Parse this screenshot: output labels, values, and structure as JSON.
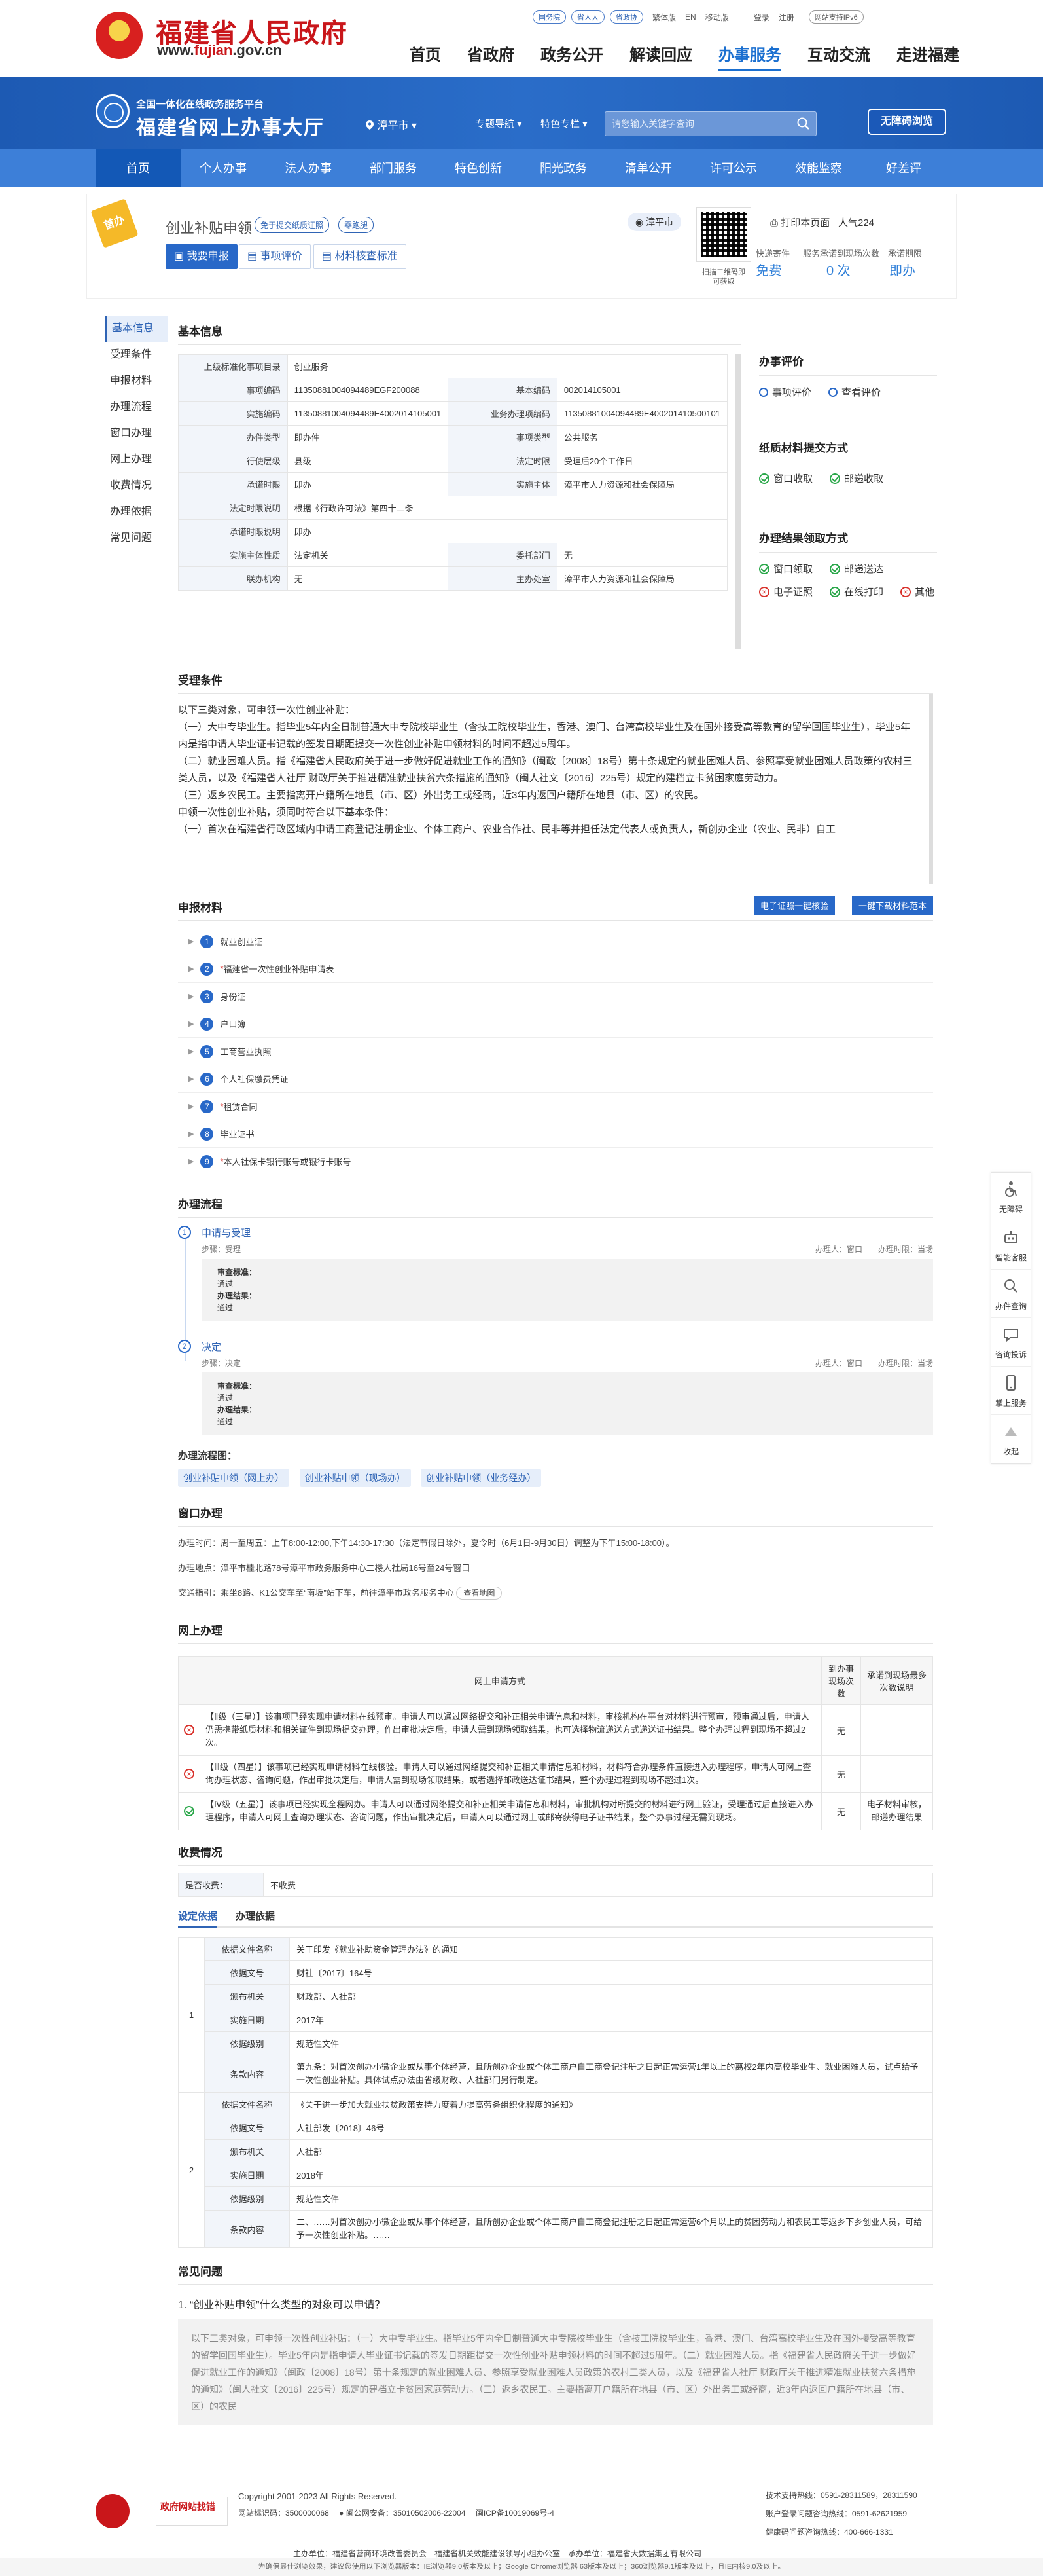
{
  "top": {
    "title": "福建省人民政府",
    "url_prefix": "www.",
    "url_main": "fujian",
    "url_suffix": ".gov.cn",
    "pill_links": [
      "国务院",
      "省人大",
      "省政协"
    ],
    "links": [
      "繁体版",
      "EN",
      "移动版",
      "登录",
      "注册"
    ],
    "ipv6": "网站支持IPv6",
    "nav": [
      "首页",
      "省政府",
      "政务公开",
      "解读回应",
      "办事服务",
      "互动交流",
      "走进福建"
    ],
    "nav_active": "办事服务"
  },
  "banner": {
    "sub": "全国一体化在线政务服务平台",
    "title": "福建省网上办事大厅",
    "city": "漳平市",
    "menu1": "专题导航",
    "menu2": "特色专栏",
    "search_placeholder": "请您输入关键字查询",
    "accessible": "无障碍浏览"
  },
  "subnav": [
    "首页",
    "个人办事",
    "法人办事",
    "部门服务",
    "特色创新",
    "阳光政务",
    "清单公开",
    "许可公示",
    "效能监察",
    "好差评"
  ],
  "item": {
    "ribbon": "首办",
    "title": "创业补贴申领",
    "tag1": "免于提交纸质证照",
    "tag2": "零跑腿",
    "btn_apply": "我要申报",
    "btn_eval": "事项评价",
    "btn_check": "材料核查标准",
    "location": "漳平市",
    "qr_label": "扫描二维码即可获取",
    "print": "打印本页面",
    "popularity": "人气224",
    "stat1_label": "快递寄件",
    "stat1_value": "免费",
    "stat2_label": "服务承诺到现场次数",
    "stat2_value": "0 次",
    "stat3_label": "承诺期限",
    "stat3_value": "即办"
  },
  "left_nav": [
    "基本信息",
    "受理条件",
    "申报材料",
    "办理流程",
    "窗口办理",
    "网上办理",
    "收费情况",
    "办理依据",
    "常见问题"
  ],
  "basic": {
    "title": "基本信息",
    "rows": [
      [
        [
          "上级标准化事项目录",
          "创业服务"
        ]
      ],
      [
        [
          "事项编码",
          "11350881004094489EGF200088"
        ],
        [
          "基本编码",
          "002014105001"
        ]
      ],
      [
        [
          "实施编码",
          "11350881004094489E4002014105001"
        ],
        [
          "业务办理项编码",
          "11350881004094489E400201410500101"
        ]
      ],
      [
        [
          "办件类型",
          "即办件"
        ],
        [
          "事项类型",
          "公共服务"
        ]
      ],
      [
        [
          "行使层级",
          "县级"
        ],
        [
          "法定时限",
          "受理后20个工作日"
        ]
      ],
      [
        [
          "承诺时限",
          "即办"
        ],
        [
          "实施主体",
          "漳平市人力资源和社会保障局"
        ]
      ],
      [
        [
          "法定时限说明",
          "根据《行政许可法》第四十二条"
        ]
      ],
      [
        [
          "承诺时限说明",
          "即办"
        ]
      ],
      [
        [
          "实施主体性质",
          "法定机关"
        ],
        [
          "委托部门",
          "无"
        ]
      ],
      [
        [
          "联办机构",
          "无"
        ],
        [
          "主办处室",
          "漳平市人力资源和社会保障局"
        ]
      ]
    ]
  },
  "side": {
    "eval_title": "办事评价",
    "eval_items": [
      "事项评价",
      "查看评价"
    ],
    "submit_title": "纸质材料提交方式",
    "submit_items": [
      "窗口收取",
      "邮递收取"
    ],
    "result_title": "办理结果领取方式",
    "result_ok": [
      "窗口领取",
      "邮递送达"
    ],
    "result_other": [
      "电子证照",
      "在线打印",
      "其他"
    ]
  },
  "accept": {
    "title": "受理条件",
    "lines": [
      "以下三类对象，可申领一次性创业补贴：",
      "（一）大中专毕业生。指毕业5年内全日制普通大中专院校毕业生（含技工院校毕业生，香港、澳门、台湾高校毕业生及在国外接受高等教育的留学回国毕业生），毕业5年内是指申请人毕业证书记载的签发日期距提交一次性创业补贴申领材料的时间不超过5周年。",
      "（二）就业困难人员。指《福建省人民政府关于进一步做好促进就业工作的通知》（闽政〔2008〕18号）第十条规定的就业困难人员、参照享受就业困难人员政策的农村三类人员，以及《福建省人社厅 财政厅关于推进精准就业扶贫六条措施的通知》（闽人社文〔2016〕225号）规定的建档立卡贫困家庭劳动力。",
      "（三）返乡农民工。主要指离开户籍所在地县（市、区）外出务工或经商，近3年内返回户籍所在地县（市、区）的农民。",
      "申领一次性创业补贴，须同时符合以下基本条件：",
      "（一）首次在福建省行政区域内申请工商登记注册企业、个体工商户、农业合作社、民非等并担任法定代表人或负责人，新创办企业（农业、民非）自工"
    ]
  },
  "materials": {
    "title": "申报材料",
    "btn_download": "电子证照一键核验",
    "btn_all": "一键下载材料范本",
    "items": [
      "就业创业证",
      "福建省一次性创业补贴申请表",
      "身份证",
      "户口簿",
      "工商营业执照",
      "个人社保缴费凭证",
      "租赁合同",
      "毕业证书",
      "本人社保卡银行账号或银行卡账号"
    ],
    "required": [
      false,
      true,
      false,
      false,
      false,
      false,
      true,
      false,
      true
    ]
  },
  "process": {
    "title": "办理流程",
    "steps": [
      {
        "num": "1",
        "name": "申请与受理",
        "sub": "步骤：受理",
        "person": "办理人：窗口",
        "time": "办理时限：当场",
        "std_label": "审查标准：",
        "std": "通过",
        "res_label": "办理结果：",
        "res": "通过"
      },
      {
        "num": "2",
        "name": "决定",
        "sub": "步骤：决定",
        "person": "办理人：窗口",
        "time": "办理时限：当场",
        "std_label": "审查标准：",
        "std": "通过",
        "res_label": "办理结果：",
        "res": "通过"
      }
    ],
    "flow_label": "办理流程图：",
    "flow_links": [
      "创业补贴申领（网上办）",
      "创业补贴申领（现场办）",
      "创业补贴申领（业务经办）"
    ]
  },
  "window": {
    "title": "窗口办理",
    "time": "办理时间：周一至周五：上午8:00-12:00,下午14:30-17:30（法定节假日除外，夏令时（6月1日-9月30日）调整为下午15:00-18:00）。",
    "addr": "办理地点：漳平市桂北路78号漳平市政务服务中心二楼人社局16号至24号窗口",
    "traffic": "交通指引：乘坐8路、K1公交车至“南坂”站下车，前往漳平市政务服务中心",
    "map_btn": "查看地图"
  },
  "online": {
    "title": "网上办理",
    "head": [
      "网上申请方式",
      "到办事现场次数",
      "承诺到现场最多次数说明"
    ],
    "rows": [
      {
        "ok": false,
        "text": "【Ⅱ级（三星）】该事项已经实现申请材料在线预审。申请人可以通过网络提交和补正相关申请信息和材料，审核机构在平台对材料进行预审，预审通过后，申请人仍需携带纸质材料和相关证件到现场提交办理，作出审批决定后，申请人需到现场领取结果，也可选择物流递送方式递送证书结果。整个办理过程到现场不超过2次。",
        "times": "无",
        "note": ""
      },
      {
        "ok": false,
        "text": "【Ⅲ级（四星）】该事项已经实现申请材料在线核验。申请人可以通过网络提交和补正相关申请信息和材料，材料符合办理条件直接进入办理程序，申请人可网上查询办理状态、咨询问题，作出审批决定后，申请人需到现场领取结果，或者选择邮政送达证书结果，整个办理过程到现场不超过1次。",
        "times": "无",
        "note": ""
      },
      {
        "ok": true,
        "text": "【Ⅳ级（五星）】该事项已经实现全程网办。申请人可以通过网络提交和补正相关申请信息和材料，审批机构对所提交的材料进行网上验证，受理通过后直接进入办理程序，申请人可网上查询办理状态、咨询问题，作出审批决定后，申请人可以通过网上或邮寄获得电子证书结果，整个办事过程无需到现场。",
        "times": "无",
        "note": "电子材料审核，邮递办理结果"
      }
    ]
  },
  "fee": {
    "title": "收费情况",
    "label": "是否收费：",
    "value": "不收费"
  },
  "basis": {
    "tab1": "设定依据",
    "tab2": "办理依据",
    "groups": [
      {
        "num": "1",
        "rows": [
          [
            "依据文件名称",
            "关于印发《就业补助资金管理办法》的通知"
          ],
          [
            "依据文号",
            "财社〔2017〕164号"
          ],
          [
            "颁布机关",
            "财政部、人社部"
          ],
          [
            "实施日期",
            "2017年"
          ],
          [
            "依据级别",
            "规范性文件"
          ],
          [
            "条款内容",
            "第九条：对首次创办小微企业或从事个体经营，且所创办企业或个体工商户自工商登记注册之日起正常运营1年以上的离校2年内高校毕业生、就业困难人员，试点给予一次性创业补贴。具体试点办法由省级财政、人社部门另行制定。"
          ]
        ]
      },
      {
        "num": "2",
        "rows": [
          [
            "依据文件名称",
            "《关于进一步加大就业扶贫政策支持力度着力提高劳务组织化程度的通知》"
          ],
          [
            "依据文号",
            "人社部发〔2018〕46号"
          ],
          [
            "颁布机关",
            "人社部"
          ],
          [
            "实施日期",
            "2018年"
          ],
          [
            "依据级别",
            "规范性文件"
          ],
          [
            "条款内容",
            "二、……对首次创办小微企业或从事个体经营，且所创办企业或个体工商户自工商登记注册之日起正常运营6个月以上的贫困劳动力和农民工等返乡下乡创业人员，可给予一次性创业补贴。……"
          ]
        ]
      }
    ]
  },
  "faq": {
    "title": "常见问题",
    "q": "1. “创业补贴申领”什么类型的对象可以申请？",
    "a": "以下三类对象，可申领一次性创业补贴：（一）大中专毕业生。指毕业5年内全日制普通大中专院校毕业生（含技工院校毕业生，香港、澳门、台湾高校毕业生及在国外接受高等教育的留学回国毕业生）。毕业5年内是指申请人毕业证书记载的签发日期距提交一次性创业补贴申领材料的时间不超过5周年。（二）就业困难人员。指《福建省人民政府关于进一步做好促进就业工作的通知》（闽政〔2008〕18号）第十条规定的就业困难人员、参照享受就业困难人员政策的农村三类人员，以及《福建省人社厅 财政厅关于推进精准就业扶贫六条措施的通知》（闽人社文〔2016〕225号）规定的建档立卡贫困家庭劳动力。（三）返乡农民工。主要指离开户籍所在地县（市、区）外出务工或经商，近3年内返回户籍所在地县（市、区）的农民"
  },
  "float": [
    "无障碍",
    "智能客服",
    "办件查询",
    "咨询投诉",
    "掌上服务",
    "收起"
  ],
  "footer": {
    "badge1": "政府网站找错",
    "copyright": "Copyright 2001-2023 All Rights Reserved.",
    "code": "网站标识码：3500000068",
    "icp1": "闽公网安备：35010502006-22004",
    "icp2": "闽ICP备10019069号-4",
    "host": "主办单位：福建省营商环境改善委员会　福建省机关效能建设领导小组办公室　承办单位：福建省大数据集团有限公司",
    "phone1": "技术支持热线：0591-28311589，28311590",
    "phone2": "账户登录问题咨询热线：0591-62621959",
    "phone3": "健康码问题咨询热线：400-666-1331",
    "bottom": "为确保最佳浏览效果，建议您使用以下浏览器版本：IE浏览器9.0版本及以上；Google Chrome浏览器 63版本及以上；360浏览器9.1版本及以上，且IE内核9.0及以上。"
  }
}
